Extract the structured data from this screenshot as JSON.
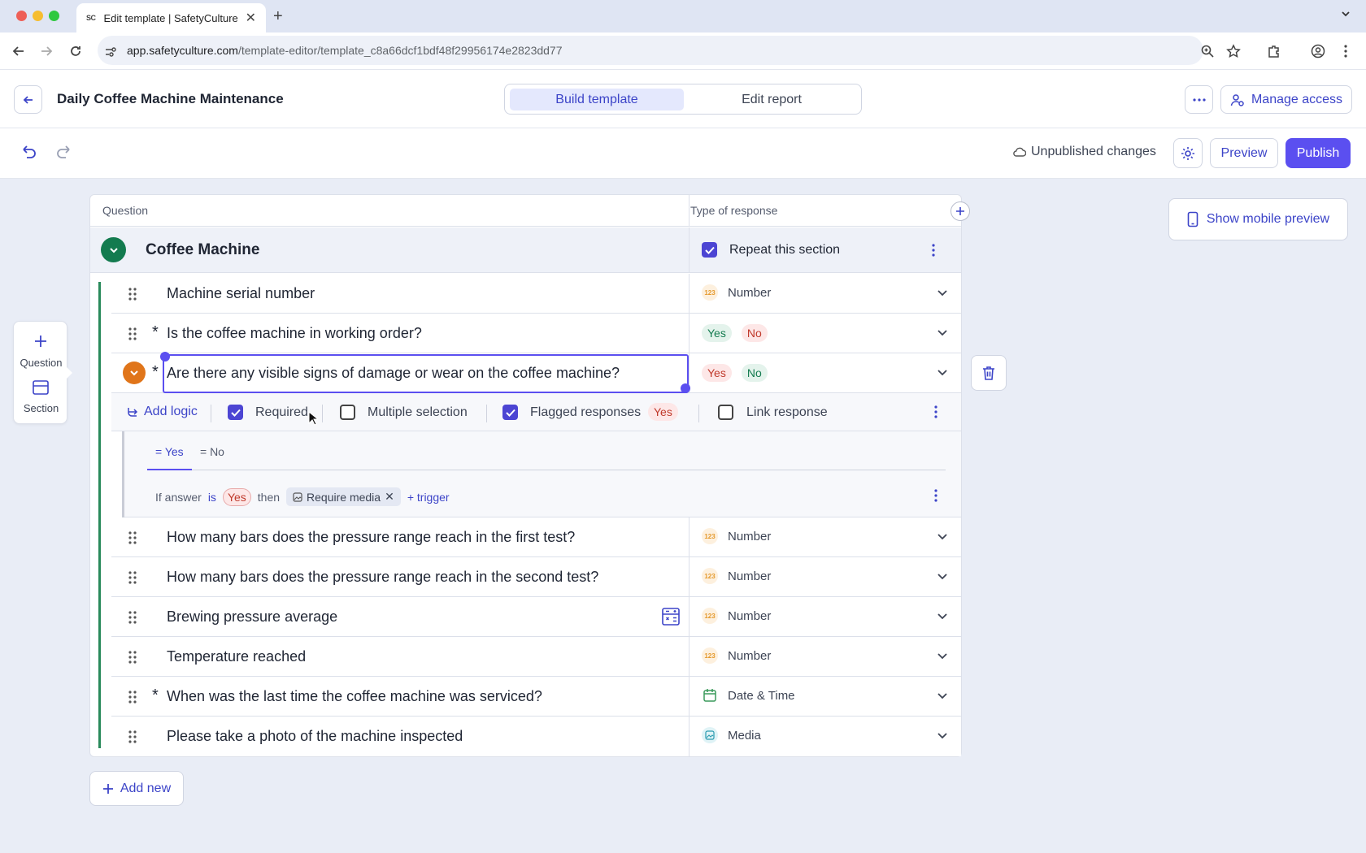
{
  "browser": {
    "tab_title": "Edit template | SafetyCulture",
    "tab_favicon": "SC",
    "url_host": "app.safetyculture.com",
    "url_path": "/template-editor/template_c8a66dcf1bdf48f29956174e2823dd77"
  },
  "header": {
    "template_title": "Daily Coffee Machine Maintenance",
    "tabs": [
      "Build template",
      "Edit report"
    ],
    "manage_access": "Manage access"
  },
  "toolbar": {
    "status": "Unpublished changes",
    "preview": "Preview",
    "publish": "Publish"
  },
  "table": {
    "col_question": "Question",
    "col_response": "Type of response"
  },
  "section": {
    "name": "Coffee Machine",
    "repeat_label": "Repeat this section",
    "repeat_checked": true
  },
  "questions": [
    {
      "text": "Machine serial number",
      "required": false,
      "response": "Number",
      "icon": "number-icon"
    },
    {
      "text": "Is the coffee machine in working order?",
      "required": true,
      "response_yes": "Yes",
      "response_no": "No"
    },
    {
      "text": "Are there any visible signs of damage or wear on the coffee machine?",
      "required": true,
      "response_yes": "Yes",
      "response_no": "No"
    },
    {
      "text": "How many bars does the pressure range reach in the first test?",
      "required": false,
      "response": "Number",
      "icon": "number-icon"
    },
    {
      "text": "How many bars does the pressure range reach in the second test?",
      "required": false,
      "response": "Number",
      "icon": "number-icon"
    },
    {
      "text": "Brewing pressure average",
      "required": false,
      "response": "Number",
      "icon": "number-icon"
    },
    {
      "text": "Temperature reached",
      "required": false,
      "response": "Number",
      "icon": "number-icon"
    },
    {
      "text": "When was the last time the coffee machine was serviced?",
      "required": true,
      "response": "Date & Time",
      "icon": "calendar-icon"
    },
    {
      "text": "Please take a photo of the machine inspected",
      "required": false,
      "response": "Media",
      "icon": "media-icon"
    }
  ],
  "options": {
    "add_logic": "Add logic",
    "required": "Required",
    "required_checked": true,
    "multiple_selection": "Multiple selection",
    "multiple_checked": false,
    "flagged_responses": "Flagged responses",
    "flagged_checked": true,
    "flagged_value": "Yes",
    "link_response": "Link response",
    "link_checked": false
  },
  "logic": {
    "tabs": [
      "= Yes",
      "= No"
    ],
    "if_answer": "If answer",
    "is": "is",
    "answer_value": "Yes",
    "then": "then",
    "action": "Require media",
    "add_trigger": "+ trigger"
  },
  "sidebar": {
    "question": "Question",
    "section": "Section"
  },
  "add_new": "Add new",
  "mobile_preview": "Show mobile preview",
  "colors": {
    "accent": "#5b4ff0",
    "section_green": "#137b4f",
    "orange": "#e0751a"
  }
}
